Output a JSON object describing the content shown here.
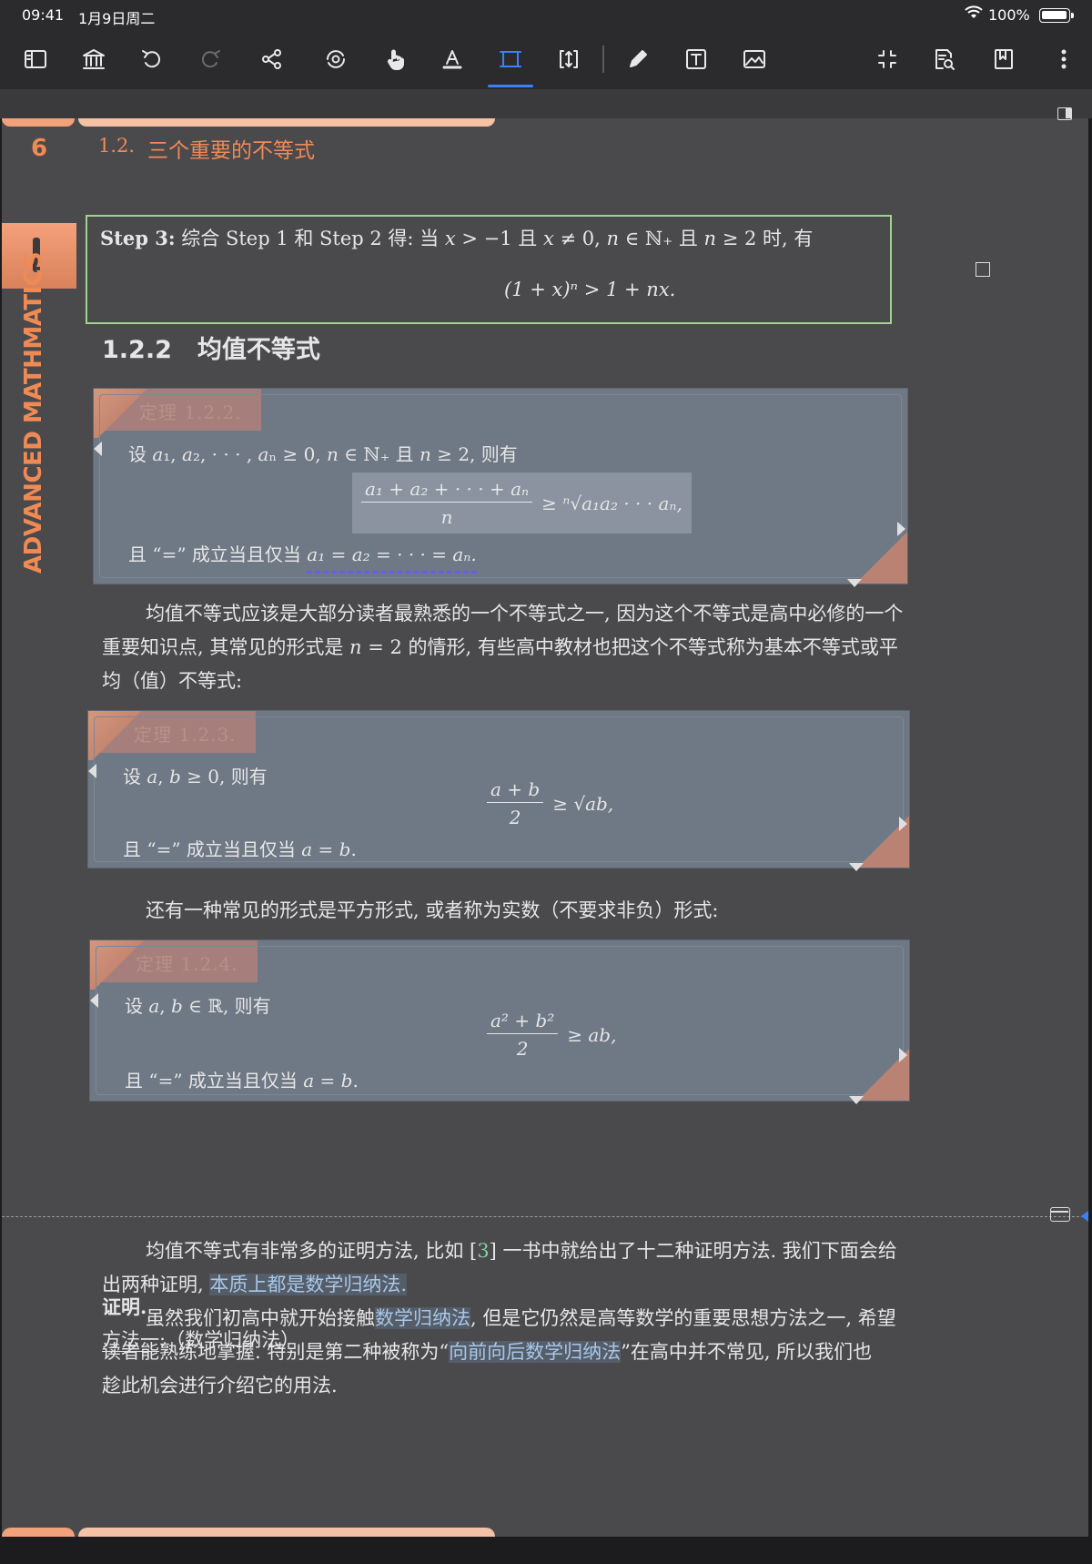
{
  "status": {
    "time": "09:41",
    "date": "1月9日周二",
    "battery": "100%"
  },
  "toolbar": {
    "icons": [
      "sidebar-icon",
      "library-icon",
      "undo-icon",
      "redo-icon",
      "share-icon",
      "rotate-sync-icon",
      "hand-icon",
      "text-highlight-icon",
      "crop-select-icon",
      "resize-icon",
      "pen-icon",
      "text-box-icon",
      "image-icon",
      "collapse-icon",
      "search-document-icon",
      "bookmark-icon",
      "more-icon"
    ],
    "active": "crop-select-icon"
  },
  "header": {
    "page_number": "6",
    "section_number": "1.2.",
    "section_title": "三个重要的不等式",
    "side_label": "ADVANCED MATHMATICS"
  },
  "step3": {
    "label": "Step 3:",
    "text": " 综合 Step 1 和 Step 2 得: 当 𝑥 > −1 且 𝑥 ≠ 0, 𝑛 ∈ ℕ₊ 且 𝑛 ≥ 2 时, 有",
    "formula": "(1 + 𝑥)ⁿ > 1 + 𝑛𝑥."
  },
  "subsection": {
    "number": "1.2.2",
    "title": "均值不等式"
  },
  "theorems": [
    {
      "tag": "定理 1.2.2.",
      "line1": "设 𝑎₁, 𝑎₂, · · · , 𝑎ₙ ≥ 0, 𝑛 ∈ ℕ₊ 且 𝑛 ≥ 2, 则有",
      "numerator": "𝑎₁ + 𝑎₂ + · · · + 𝑎ₙ",
      "denominator": "𝑛",
      "rhs": "≥ ⁿ√𝑎₁𝑎₂ · · · 𝑎ₙ,",
      "line3_prefix": "且 “=” 成立当且仅当 ",
      "line3_math": "𝑎₁ = 𝑎₂ = · · · = 𝑎ₙ."
    },
    {
      "tag": "定理 1.2.3.",
      "line1": "设 𝑎, 𝑏 ≥ 0, 则有",
      "numerator": "𝑎 + 𝑏",
      "denominator": "2",
      "rhs": "≥ √𝑎𝑏,",
      "line3": "且 “=” 成立当且仅当 𝑎 = 𝑏."
    },
    {
      "tag": "定理 1.2.4.",
      "line1": "设 𝑎, 𝑏 ∈ ℝ, 则有",
      "numerator": "𝑎² + 𝑏²",
      "denominator": "2",
      "rhs": "≥ 𝑎𝑏,",
      "line3": "且 “=” 成立当且仅当 𝑎 = 𝑏."
    }
  ],
  "paragraphs": {
    "p1_l1": "均值不等式应该是大部分读者最熟悉的一个不等式之一, 因为这个不等式是高中必修的一个",
    "p1_l2": "重要知识点, 其常见的形式是 𝑛 = 2 的情形, 有些高中教材也把这个不等式称为基本不等式或平",
    "p1_l3": "均（值）不等式:",
    "p2": "还有一种常见的形式是平方形式, 或者称为实数（不要求非负）形式:",
    "p3_l1_a": "均值不等式有非常多的证明方法, 比如 [",
    "p3_l1_cite": "3",
    "p3_l1_b": "] 一书中就给出了十二种证明方法. 我们下面会给",
    "p3_l2_a": "出两种证明, ",
    "p3_l2_hl": "本质上都是数学归纳法.",
    "p4_l1_a": "虽然我们初高中就开始接触",
    "p4_l1_hl": "数学归纳法",
    "p4_l1_b": ", 但是它仍然是高等数学的重要思想方法之一, 希望",
    "p4_l2_a": "读者能熟练地掌握. 特别是第二种被称为“",
    "p4_l2_hl": "向前向后数学归纳法",
    "p4_l2_b": "”在高中并不常见, 所以我们也",
    "p4_l3": "趁此机会进行介绍它的用法.",
    "proof": "证明.",
    "method_u": "方法一",
    "method_rest": ":（数学归纳法）"
  },
  "colors": {
    "accent": "#3b82f6",
    "orange": "#f08a55",
    "theorem_bg": "#6f7885",
    "step_border": "#9ed48f",
    "page_bg": "#4a4a4d"
  }
}
